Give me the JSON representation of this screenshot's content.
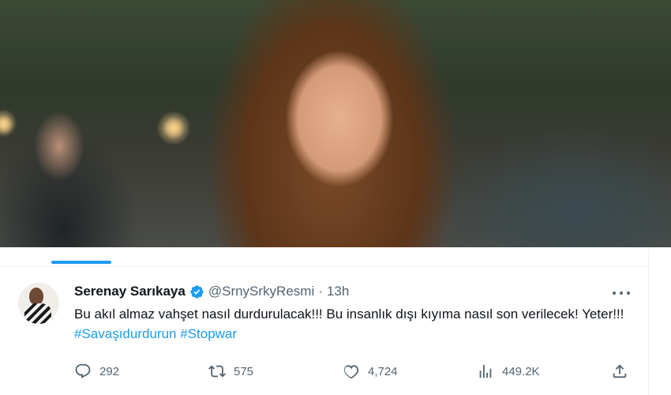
{
  "photo": {
    "alt_subject": "actress-portrait"
  },
  "tweet": {
    "author_name": "Serenay Sarıkaya",
    "handle": "@SrnySrkyResmi",
    "separator": "·",
    "time": "13h",
    "text_plain": "Bu akıl almaz vahşet nasıl durdurulacak!!! Bu insanlık dışı kıyıma nasıl son verilecek! Yeter!!! ",
    "hashtags": [
      "#Savaşıdurdurun",
      "#Stopwar"
    ],
    "verified": true
  },
  "metrics": {
    "replies": "292",
    "retweets": "575",
    "likes": "4,724",
    "views": "449.2K"
  },
  "icons": {
    "reply": "reply-icon",
    "retweet": "retweet-icon",
    "like": "heart-icon",
    "views": "views-chart-icon",
    "share": "share-icon",
    "more": "more-dots-icon",
    "verified": "verified-badge-icon"
  },
  "colors": {
    "accent": "#1d9bf0",
    "text": "#0f1419",
    "secondary": "#536471"
  }
}
